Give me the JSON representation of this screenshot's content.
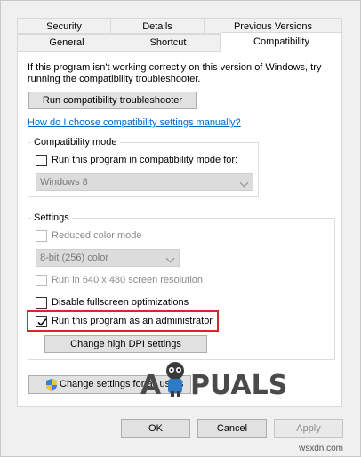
{
  "tabs_row1": [
    "Security",
    "Details",
    "Previous Versions"
  ],
  "tabs_row2": [
    "General",
    "Shortcut",
    "Compatibility"
  ],
  "active_tab": "Compatibility",
  "intro_text_line1": "If this program isn't working correctly on this version of Windows, try",
  "intro_text_line2": "running the compatibility troubleshooter.",
  "troubleshooter_button": "Run compatibility troubleshooter",
  "help_link": "How do I choose compatibility settings manually?",
  "compat_mode": {
    "legend": "Compatibility mode",
    "checkbox_label": "Run this program in compatibility mode for:",
    "checked": false,
    "os_value": "Windows 8"
  },
  "settings": {
    "legend": "Settings",
    "reduced_color_label": "Reduced color mode",
    "color_value": "8-bit (256) color",
    "run_640_label": "Run in 640 x 480 screen resolution",
    "disable_fullscreen_label": "Disable fullscreen optimizations",
    "run_admin_label": "Run this program as an administrator",
    "run_admin_checked": true,
    "dpi_button": "Change high DPI settings"
  },
  "change_all_users_button": "Change settings for all users",
  "footer": {
    "ok": "OK",
    "cancel": "Cancel",
    "apply": "Apply"
  },
  "watermark": {
    "left": "A",
    "right": "PUALS",
    "site": "wsxdn.com"
  },
  "colors": {
    "highlight": "#d9262b",
    "link": "#0066cc"
  }
}
